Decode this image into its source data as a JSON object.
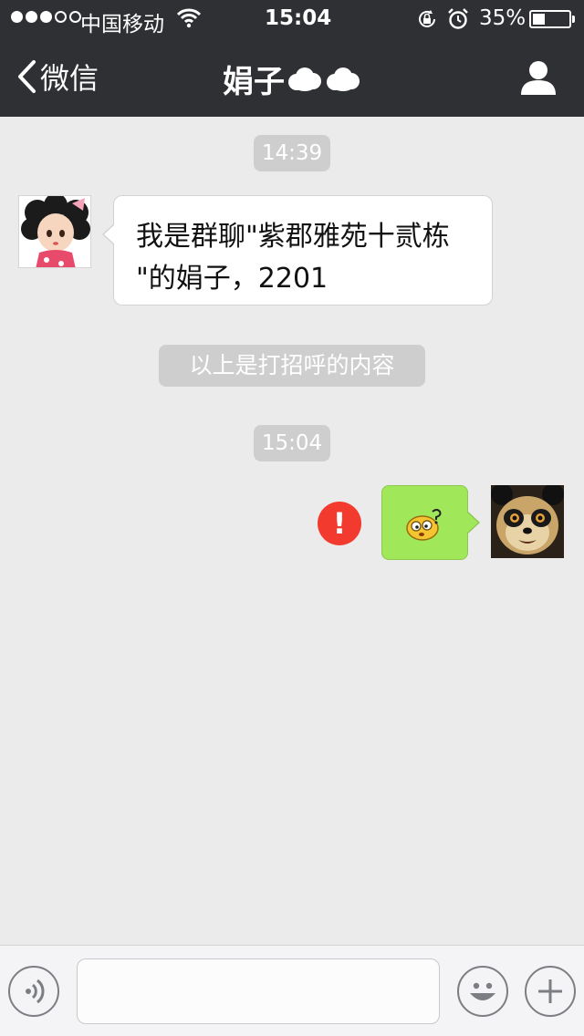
{
  "status_bar": {
    "signal_filled": 3,
    "signal_total": 5,
    "carrier": "中国移动",
    "time": "15:04",
    "battery_percent": "35%",
    "battery_level": 0.35
  },
  "nav": {
    "back_label": "微信",
    "title": "娟子",
    "title_decoration": "cloud-emoji-icon x2",
    "profile_icon": "person-icon"
  },
  "messages": [
    {
      "type": "timestamp",
      "text": "14:39"
    },
    {
      "type": "incoming",
      "avatar": "doll-avatar",
      "lines": [
        "我是群聊\"紫郡雅苑十贰栋",
        "\"的娟子，2201"
      ]
    },
    {
      "type": "system",
      "text": "以上是打招呼的内容"
    },
    {
      "type": "timestamp",
      "text": "15:04"
    },
    {
      "type": "outgoing",
      "content": "confused-face-emoji",
      "status": "send-failed",
      "avatar": "panda-avatar"
    }
  ],
  "input_bar": {
    "value": "",
    "icons": [
      "voice-icon",
      "smiley-icon",
      "plus-icon"
    ]
  },
  "colors": {
    "header": "#2f3034",
    "background": "#ebebeb",
    "outgoing_bubble": "#a0e75a",
    "error": "#f23a2f"
  }
}
